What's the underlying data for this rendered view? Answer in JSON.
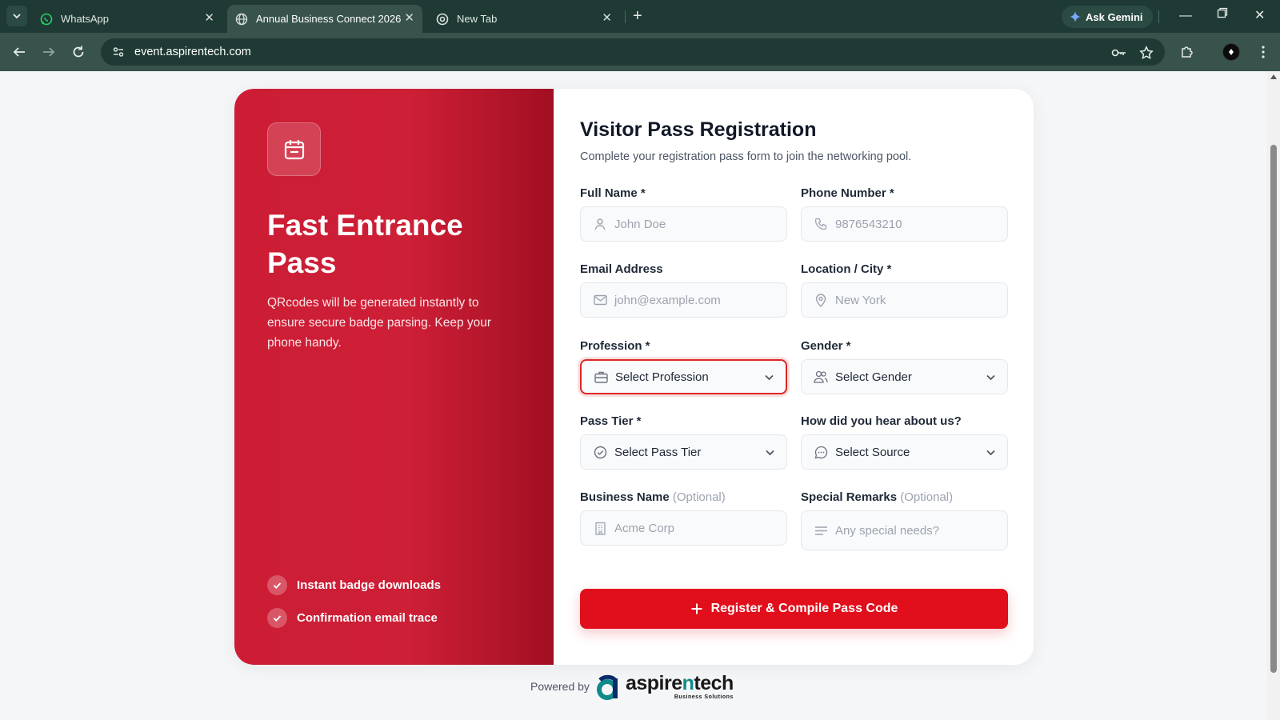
{
  "browser": {
    "tabs": [
      {
        "title": "WhatsApp",
        "icon": "whatsapp-icon",
        "active": false
      },
      {
        "title": "Annual Business Connect 2026",
        "icon": "globe-icon",
        "active": true
      },
      {
        "title": "New Tab",
        "icon": "chrome-icon",
        "active": false
      }
    ],
    "gemini_label": "Ask Gemini",
    "url": "event.aspirentech.com"
  },
  "left_panel": {
    "title": "Fast Entrance Pass",
    "description": "QRcodes will be generated instantly to ensure secure badge parsing. Keep your phone handy.",
    "features": [
      "Instant badge downloads",
      "Confirmation email trace"
    ]
  },
  "form": {
    "title": "Visitor Pass Registration",
    "subtitle": "Complete your registration pass form to join the networking pool.",
    "fields": {
      "full_name": {
        "label": "Full Name *",
        "placeholder": "John Doe"
      },
      "phone": {
        "label": "Phone Number *",
        "placeholder": "9876543210"
      },
      "email": {
        "label": "Email Address",
        "placeholder": "john@example.com"
      },
      "location": {
        "label": "Location / City *",
        "placeholder": "New York"
      },
      "profession": {
        "label": "Profession *",
        "value": "Select Profession"
      },
      "gender": {
        "label": "Gender *",
        "value": "Select Gender"
      },
      "pass_tier": {
        "label": "Pass Tier *",
        "value": "Select Pass Tier"
      },
      "source": {
        "label": "How did you hear about us?",
        "value": "Select Source"
      },
      "business": {
        "label": "Business Name",
        "optional": "(Optional)",
        "placeholder": "Acme Corp"
      },
      "remarks": {
        "label": "Special Remarks",
        "optional": "(Optional)",
        "placeholder": "Any special needs?"
      }
    },
    "submit_label": "Register & Compile Pass Code"
  },
  "footer": {
    "powered_by": "Powered by",
    "logo_word_1": "aspire",
    "logo_word_2": "n",
    "logo_word_3": "tech",
    "logo_sub": "Business Solutions"
  },
  "colors": {
    "accent": "#e10f1b",
    "panel": "#cc1d35",
    "browser_frame": "#1f3a35"
  }
}
